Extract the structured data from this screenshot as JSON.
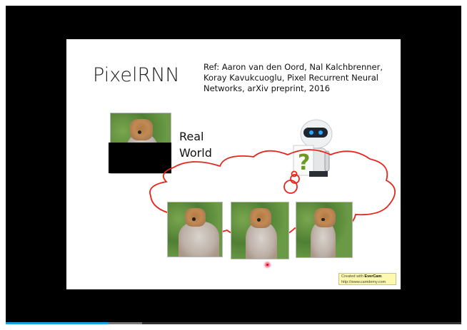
{
  "slide": {
    "title": "PixelRNN",
    "reference": "Ref: Aaron van den Oord, Nal Kalchbrenner, Koray Kavukcuoglu, Pixel Recurrent Neural Networks, arXiv preprint, 2016",
    "real_world_label_line1": "Real",
    "real_world_label_line2": "World",
    "robot_icon": "robot-holding-question-mark",
    "question_mark": "?",
    "thought_cloud_color": "#e8251b"
  },
  "watermark": {
    "prefix": "Created with ",
    "brand": "EverCam",
    "suffix": ".",
    "url": "http://www.camdemy.com"
  },
  "player": {
    "progress_played_percent": 22.6,
    "progress_buffered_percent": 30,
    "progress_color": "#1aa0dc"
  }
}
